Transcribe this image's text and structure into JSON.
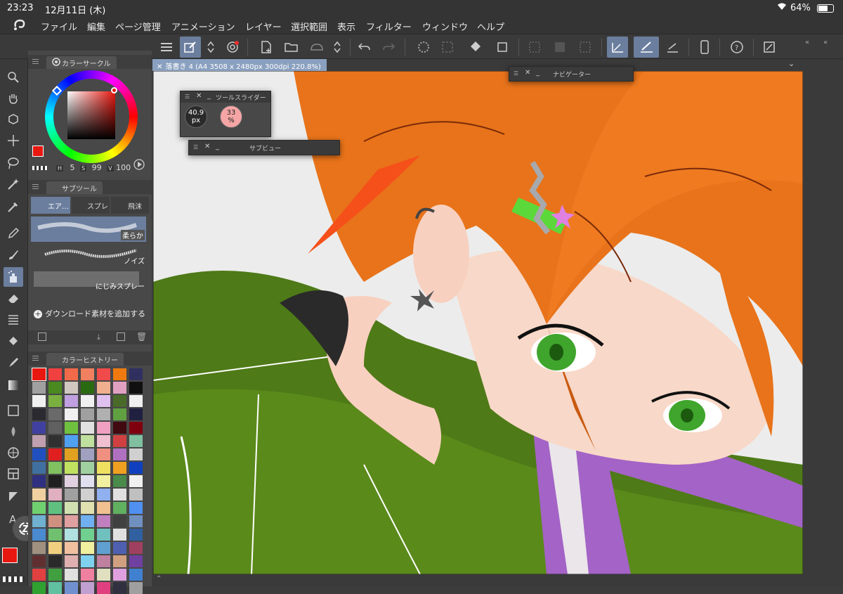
{
  "status": {
    "time": "23:23",
    "date": "12月11日 (木)",
    "battery": "64%"
  },
  "menu": [
    "ファイル",
    "編集",
    "ページ管理",
    "アニメーション",
    "レイヤー",
    "選択範囲",
    "表示",
    "フィルター",
    "ウィンドウ",
    "ヘルプ"
  ],
  "document_tab": "落書き 4 (A4 3508 x 2480px 300dpi 220.8%)",
  "color_circle": {
    "title": "カラーサークル",
    "h_label": "H",
    "h_value": "5",
    "s_label": "S",
    "s_value": "99",
    "v_label": "V",
    "v_value": "100",
    "main_color": "#e8170f",
    "sub_color": "#e6e3b8"
  },
  "subtool": {
    "title": "サブツール",
    "tabs": [
      "エア…",
      "スプレ",
      "飛沫"
    ],
    "brushes": [
      "柔らか",
      "ノイズ",
      "にじみスプレー"
    ],
    "add_material": "ダウンロード素材を追加する"
  },
  "color_history": {
    "title": "カラーヒストリー"
  },
  "tool_slider": {
    "title": "ツールスライダー",
    "size_value": "40.9",
    "size_unit": "px",
    "opacity_value": "33",
    "opacity_unit": "%"
  },
  "sub_view": {
    "title": "サブビュー"
  },
  "navigator": {
    "title": "ナビゲーター"
  },
  "colors": {
    "accent": "#6b7e9e",
    "tab_blue": "#8aa0c0",
    "panel": "#484848",
    "hair": "#e8731a",
    "jacket": "#4e7a17"
  },
  "swatches": [
    "#e8170f",
    "#f04040",
    "#f06a4a",
    "#f08060",
    "#f04a4a",
    "#f07a10",
    "#303060",
    "#a0a0a0",
    "#4a8a20",
    "#d0c8c0",
    "#2a6a10",
    "#f0b090",
    "#e0a0c0",
    "#101010",
    "#f0f0f0",
    "#7ab040",
    "#c0a0e0",
    "#f0f0f0",
    "#e0c0f0",
    "#4a6a2a",
    "#f0f0f0",
    "#2a2a30",
    "#6a6a6a",
    "#f0f0f0",
    "#a0a0a0",
    "#b0b0b0",
    "#60a040",
    "#202040",
    "#4040a0",
    "#606060",
    "#70c040",
    "#e0e0e0",
    "#f0a0c0",
    "#400a10",
    "#800010",
    "#c0a0b0",
    "#303030",
    "#50a0f0",
    "#c0e0a0",
    "#f0c0d0",
    "#d04040",
    "#80c0a0",
    "#2050c0",
    "#e02020",
    "#e0a020",
    "#a0a0c0",
    "#f09080",
    "#b070c0",
    "#d0d0d0",
    "#4070a0",
    "#80c060",
    "#c0e060",
    "#a0d0a0",
    "#f0e060",
    "#f0a020",
    "#1040c0",
    "#303080",
    "#202020",
    "#e0d0e0",
    "#e0e0f0",
    "#f0f0a0",
    "#4a8a4a",
    "#f0f0f0",
    "#f0d0a0",
    "#e0b0c0",
    "#a0a0a0",
    "#d0d0d0",
    "#90b0f0",
    "#e0e0e0",
    "#c0c0c0",
    "#70d070",
    "#60c080",
    "#d0e0b0",
    "#e0e0b0",
    "#f0c090",
    "#60b060",
    "#5090f0",
    "#70b0d0",
    "#d09080",
    "#e0a0a0",
    "#70b0f0",
    "#c080c0",
    "#404040",
    "#7090c0",
    "#4a8ad0",
    "#70c070",
    "#b0e0e0",
    "#70d090",
    "#70c0c0",
    "#e0e0e0",
    "#3060a0",
    "#a09080",
    "#f0d080",
    "#f0c0a0",
    "#f0f0a0",
    "#60a0d0",
    "#5060b0",
    "#a04060",
    "#603030",
    "#2a2a2a",
    "#e0b0b0",
    "#80d0f0",
    "#c080a0",
    "#d0a080",
    "#7040a0",
    "#e04040",
    "#40a040",
    "#e0e0e0",
    "#f080a0",
    "#e0e0c0",
    "#e0a0e0",
    "#4080d0",
    "#30a030",
    "#60c0a0",
    "#7090d0",
    "#c0a0d0",
    "#e04080",
    "#303040",
    "#a0a0a0"
  ]
}
